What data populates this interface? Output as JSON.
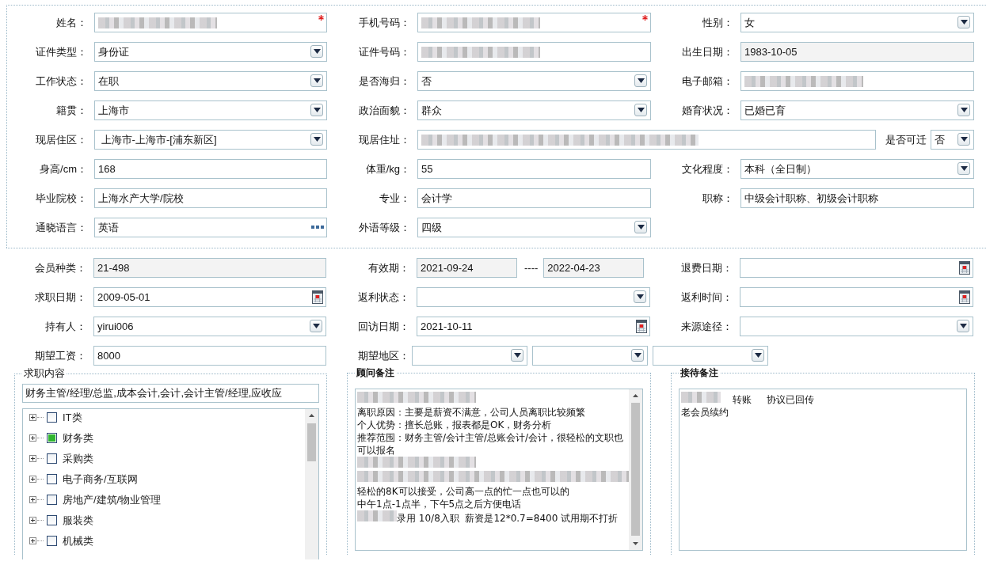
{
  "personal": {
    "rows": [
      [
        {
          "label": "姓名：",
          "kind": "text",
          "required": true,
          "redacted": true
        },
        {
          "label": "手机号码：",
          "kind": "text",
          "required": true,
          "redacted": true
        },
        {
          "label": "性别：",
          "kind": "select",
          "value": "女"
        }
      ],
      [
        {
          "label": "证件类型：",
          "kind": "select",
          "value": "身份证"
        },
        {
          "label": "证件号码：",
          "kind": "text",
          "redacted": true
        },
        {
          "label": "出生日期：",
          "kind": "readonly",
          "value": "1983-10-05"
        }
      ],
      [
        {
          "label": "工作状态：",
          "kind": "select",
          "value": "在职"
        },
        {
          "label": "是否海归：",
          "kind": "select",
          "value": "否"
        },
        {
          "label": "电子邮箱：",
          "kind": "text",
          "redacted": true
        }
      ],
      [
        {
          "label": "籍贯：",
          "kind": "select",
          "value": "上海市"
        },
        {
          "label": "政治面貌：",
          "kind": "select",
          "value": "群众"
        },
        {
          "label": "婚育状况：",
          "kind": "select",
          "value": "已婚已育"
        }
      ],
      [
        {
          "label": "现居住区：",
          "kind": "select",
          "value": " 上海市-上海市-[浦东新区]"
        },
        {
          "label": "现居住址：",
          "kind": "address",
          "redacted": true,
          "extra": {
            "label": "是否可迁",
            "value": "否"
          }
        }
      ],
      [
        {
          "label": "身高/cm：",
          "kind": "text",
          "value": "168"
        },
        {
          "label": "体重/kg：",
          "kind": "text",
          "value": "55"
        },
        {
          "label": "文化程度：",
          "kind": "select",
          "value": "本科（全日制）"
        }
      ],
      [
        {
          "label": "毕业院校：",
          "kind": "text",
          "value": "上海水产大学/院校"
        },
        {
          "label": "专业：",
          "kind": "text",
          "value": "会计学"
        },
        {
          "label": "职称：",
          "kind": "text",
          "value": "中级会计职称、初级会计职称"
        }
      ],
      [
        {
          "label": "通晓语言：",
          "kind": "lookup",
          "value": "英语"
        },
        {
          "label": "外语等级：",
          "kind": "select",
          "value": "四级"
        }
      ]
    ]
  },
  "membership": {
    "rows": [
      [
        {
          "label": "会员种类：",
          "kind": "readonly",
          "value": "21-498"
        },
        {
          "label": "有效期：",
          "kind": "range",
          "values": [
            "2021-09-24",
            "2022-04-23"
          ],
          "separator": "----"
        },
        {
          "label": "退费日期：",
          "kind": "date"
        }
      ],
      [
        {
          "label": "求职日期：",
          "kind": "date",
          "value": "2009-05-01"
        },
        {
          "label": "返利状态：",
          "kind": "select"
        },
        {
          "label": "返利时间：",
          "kind": "date"
        }
      ],
      [
        {
          "label": "持有人：",
          "kind": "select",
          "value": "yirui006"
        },
        {
          "label": "回访日期：",
          "kind": "date",
          "value": "2021-10-11"
        },
        {
          "label": "来源途径：",
          "kind": "select"
        }
      ],
      [
        {
          "label": "期望工资：",
          "kind": "text",
          "value": "8000"
        },
        {
          "label": "期望地区：",
          "kind": "multi_select",
          "slots": [
            {
              "kind": "select"
            },
            {
              "kind": "select"
            },
            {
              "kind": "select"
            }
          ]
        }
      ]
    ]
  },
  "job_content": {
    "legend": "求职内容",
    "value": "财务主管/经理/总监,成本会计,会计,会计主管/经理,应收应",
    "tree": [
      {
        "label": "IT类",
        "checked": false,
        "expanded": false
      },
      {
        "label": "财务类",
        "checked": true,
        "expanded": false
      },
      {
        "label": "采购类",
        "checked": false,
        "expanded": false
      },
      {
        "label": "电子商务/互联网",
        "checked": false,
        "expanded": false
      },
      {
        "label": "房地产/建筑/物业管理",
        "checked": false,
        "expanded": false
      },
      {
        "label": "服装类",
        "checked": false,
        "expanded": false
      },
      {
        "label": "机械类",
        "checked": false,
        "expanded": false
      }
    ]
  },
  "advisor_notes": {
    "legend": "顾问备注",
    "lines": [
      {
        "kind": "redacted"
      },
      {
        "kind": "text",
        "text": "离职原因：主要是薪资不满意，公司人员离职比较频繁"
      },
      {
        "kind": "text",
        "text": "个人优势：擅长总账，报表都是OK，财务分析"
      },
      {
        "kind": "text",
        "text": "推荐范围：财务主管/会计主管/总账会计/会计，很轻松的文职也可以报名"
      },
      {
        "kind": "redacted"
      },
      {
        "kind": "redacted"
      },
      {
        "kind": "text",
        "text": "轻松的8K可以接受，公司高一点的忙一点也可以的"
      },
      {
        "kind": "text",
        "text": "中午1点-1点半，下午5点之后方便电话"
      },
      {
        "kind": "text",
        "redacted_prefix": true,
        "text": "录用 10/8入职  薪资是12*0.7=8400 试用期不打折"
      }
    ]
  },
  "reception_notes": {
    "legend": "接待备注",
    "lines": [
      {
        "kind": "text",
        "redacted_prefix": true,
        "text": "    转账     协议已回传"
      },
      {
        "kind": "text",
        "text": "老会员续约"
      }
    ]
  }
}
